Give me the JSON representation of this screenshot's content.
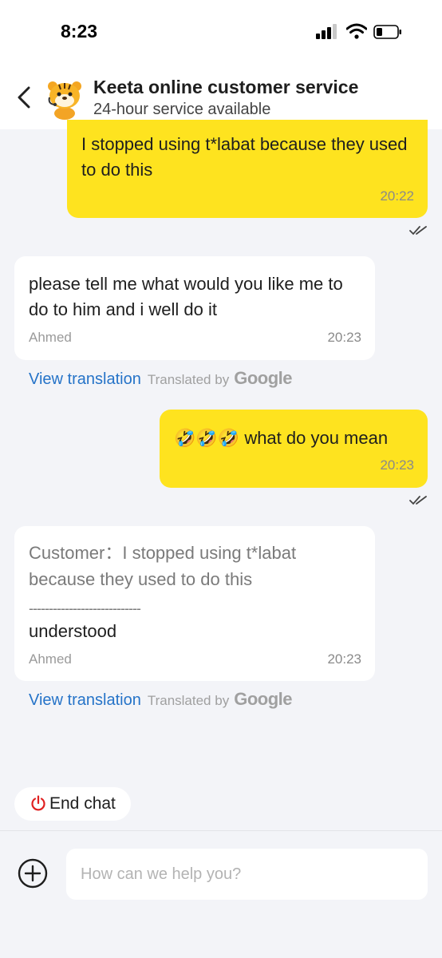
{
  "status": {
    "time": "8:23"
  },
  "header": {
    "title": "Keeta online customer service",
    "subtitle": "24-hour service available"
  },
  "messages": [
    {
      "direction": "outgoing",
      "text": "I stopped using t*labat because they used to do this",
      "time": "20:22",
      "read": true
    },
    {
      "direction": "incoming",
      "text": "please tell me what would you like me to do to him and i well do it",
      "sender": "Ahmed",
      "time": "20:23"
    },
    {
      "direction": "outgoing",
      "emoji": "🤣🤣🤣",
      "text": "what do you mean",
      "time": "20:23",
      "read": true
    },
    {
      "direction": "incoming",
      "quote": "Customer：I stopped using t*labat because they used to do this",
      "separator": "----------------------------",
      "text": "understood",
      "sender": "Ahmed",
      "time": "20:23"
    }
  ],
  "translation": {
    "view_label": "View translation",
    "translated_by": "Translated by",
    "provider": "Google"
  },
  "end_chat": {
    "label": "End chat"
  },
  "composer": {
    "placeholder": "How can we help you?"
  },
  "colors": {
    "outgoing_bubble": "#fee31f",
    "incoming_bubble": "#ffffff",
    "link": "#2573c8",
    "end_chat_icon": "#e02020",
    "background": "#f3f4f8"
  },
  "icons": [
    "back-chevron-icon",
    "tiger-avatar-icon",
    "read-receipt-icon",
    "power-icon",
    "plus-circle-icon",
    "signal-icon",
    "wifi-icon",
    "battery-icon"
  ]
}
